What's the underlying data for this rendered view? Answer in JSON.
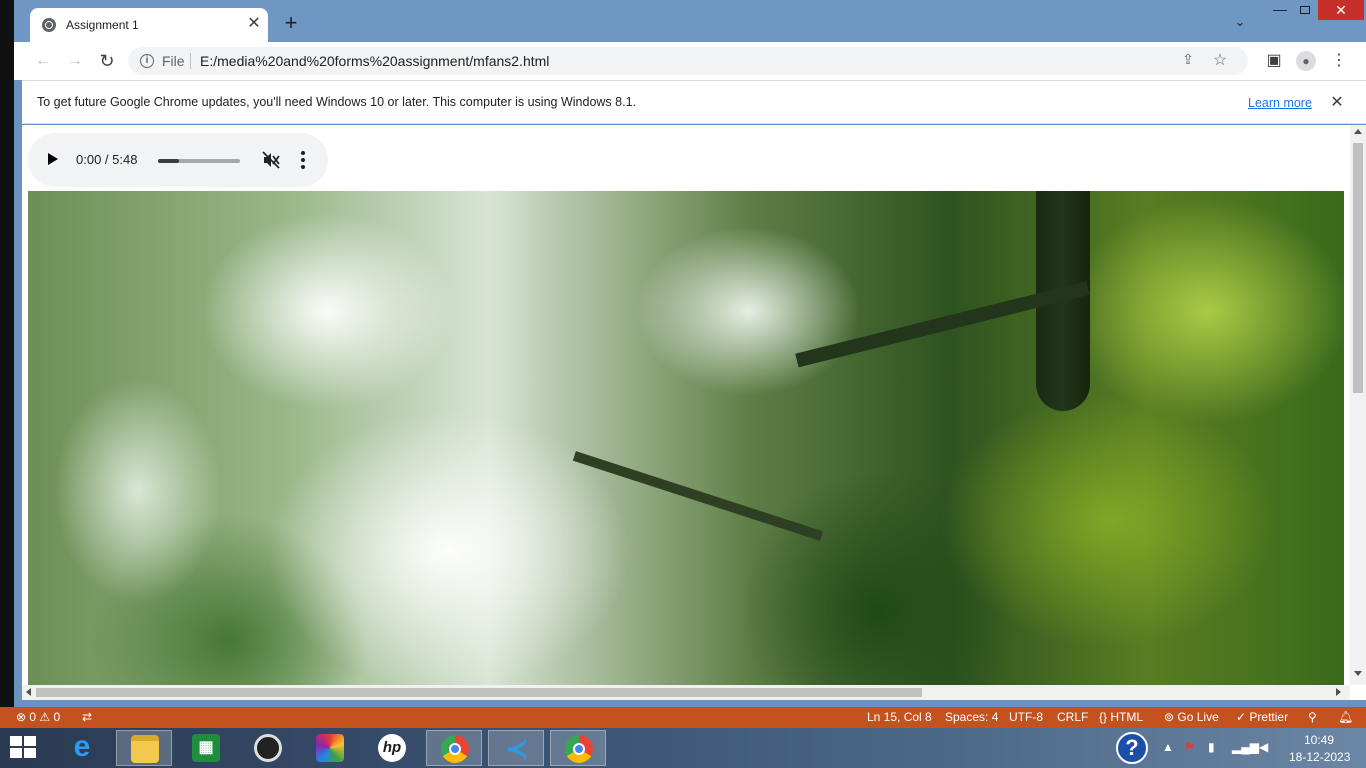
{
  "browser": {
    "tab_title": "Assignment 1",
    "tab_close": "✕",
    "new_tab": "+",
    "omnibox_scheme_label": "File",
    "url": "E:/media%20and%20forms%20assignment/mfans2.html",
    "infobar_message": "To get future Google Chrome updates, you'll need Windows 10 or later. This computer is using Windows 8.1.",
    "infobar_link": "Learn more",
    "infobar_close": "✕"
  },
  "audio_player": {
    "time": "0:00 / 5:48",
    "progress_fraction": 0.25,
    "muted": true
  },
  "vscode_status": {
    "problems": "⊗ 0 ⚠ 0",
    "cursor": "Ln 15, Col 8",
    "spaces": "Spaces: 4",
    "encoding": "UTF-8",
    "eol": "CRLF",
    "language": "{} HTML",
    "go_live": "Go Live",
    "prettier": "Prettier"
  },
  "taskbar": {
    "items": [
      {
        "name": "internet-explorer",
        "active": false
      },
      {
        "name": "file-explorer",
        "active": true
      },
      {
        "name": "excel-store",
        "active": false
      },
      {
        "name": "webcam-app",
        "active": false
      },
      {
        "name": "paint-app",
        "active": false
      },
      {
        "name": "hp-app",
        "active": false
      },
      {
        "name": "chrome-1",
        "active": true
      },
      {
        "name": "vscode",
        "active": true
      },
      {
        "name": "chrome-2",
        "active": true
      }
    ],
    "help_glyph": "?",
    "clock_time": "10:49",
    "clock_date": "18-12-2023"
  },
  "colors": {
    "chrome_frame": "#6f97c4",
    "status_bar": "#c4521f",
    "close_button": "#c7302a",
    "link": "#1a73e8"
  }
}
